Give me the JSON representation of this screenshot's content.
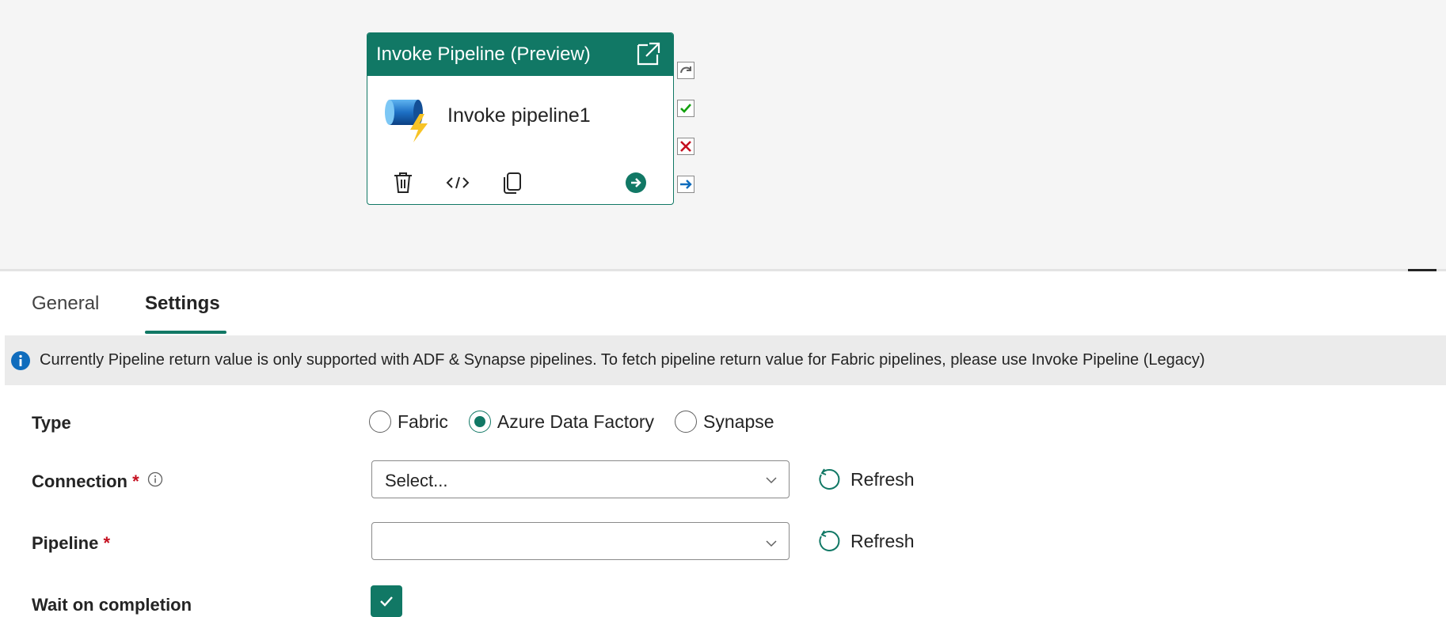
{
  "canvas": {
    "activity": {
      "header_title": "Invoke Pipeline (Preview)",
      "name": "Invoke pipeline1",
      "icons": [
        "open-external-icon",
        "pipeline-lightning-icon",
        "delete-icon",
        "code-icon",
        "copy-icon",
        "arrow-right-circle-icon"
      ]
    },
    "connectors": [
      "skip-connector-icon",
      "success-connector-icon",
      "failure-connector-icon",
      "completion-connector-icon"
    ]
  },
  "tabs": [
    {
      "label": "General",
      "active": false
    },
    {
      "label": "Settings",
      "active": true
    }
  ],
  "info": {
    "icon": "info-icon",
    "text": "Currently Pipeline return value is only supported with ADF & Synapse pipelines. To fetch pipeline return value for Fabric pipelines, please use Invoke Pipeline (Legacy)"
  },
  "form": {
    "type": {
      "label": "Type",
      "options": [
        {
          "label": "Fabric",
          "selected": false
        },
        {
          "label": "Azure Data Factory",
          "selected": true
        },
        {
          "label": "Synapse",
          "selected": false
        }
      ]
    },
    "connection": {
      "label": "Connection",
      "required_mark": "*",
      "value": "Select...",
      "refresh_label": "Refresh"
    },
    "pipeline": {
      "label": "Pipeline",
      "required_mark": "*",
      "value": "",
      "refresh_label": "Refresh"
    },
    "wait_on_completion": {
      "label": "Wait on completion",
      "checked": true
    }
  },
  "colors": {
    "accent": "#117865",
    "required": "#c50f1f",
    "success": "#13a10e",
    "failure": "#c50f1f",
    "completion": "#0f6cbd"
  }
}
